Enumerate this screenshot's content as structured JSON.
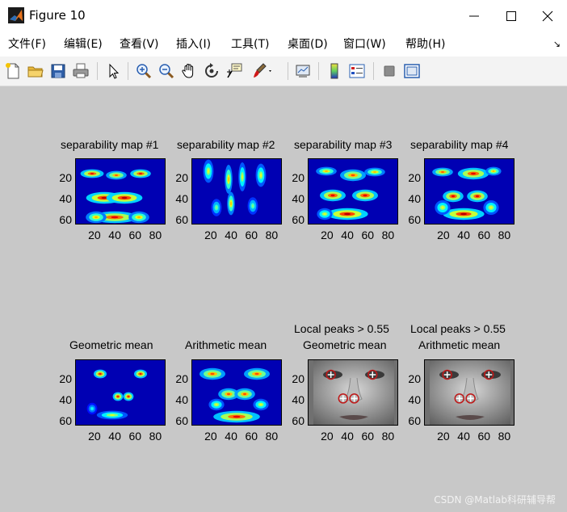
{
  "window": {
    "title": "Figure 10",
    "buttons": [
      "minimize",
      "maximize",
      "close"
    ]
  },
  "menu": {
    "items": [
      "文件(F)",
      "编辑(E)",
      "查看(V)",
      "插入(I)",
      "工具(T)",
      "桌面(D)",
      "窗口(W)",
      "帮助(H)"
    ]
  },
  "toolbar": {
    "buttons": [
      "new-figure",
      "open-file",
      "save",
      "print",
      "edit-plot",
      "zoom-in",
      "zoom-out",
      "pan",
      "rotate-3d",
      "data-cursor",
      "brush",
      "link-plot",
      "insert-colorbar",
      "insert-legend",
      "hide-plot-tools",
      "show-plot-tools"
    ]
  },
  "axes": [
    {
      "title_lines": [
        "separability map #1"
      ],
      "type": "heatmap"
    },
    {
      "title_lines": [
        "separability map #2"
      ],
      "type": "heatmap"
    },
    {
      "title_lines": [
        "separability map #3"
      ],
      "type": "heatmap"
    },
    {
      "title_lines": [
        "separability map #4"
      ],
      "type": "heatmap"
    },
    {
      "title_lines": [
        "Geometric mean"
      ],
      "type": "heatmap"
    },
    {
      "title_lines": [
        "Arithmetic mean"
      ],
      "type": "heatmap"
    },
    {
      "title_lines": [
        "Local peaks > 0.55",
        "Geometric mean"
      ],
      "type": "image"
    },
    {
      "title_lines": [
        "Local peaks > 0.55",
        "Arithmetic mean"
      ],
      "type": "image"
    }
  ],
  "chart_data": [
    {
      "type": "heatmap",
      "title": "separability map #1",
      "xticks": [
        "20",
        "40",
        "60",
        "80"
      ],
      "yticks": [
        "20",
        "40",
        "60"
      ],
      "xlim": [
        1,
        90
      ],
      "ylim": [
        1,
        65
      ],
      "colormap": "jet"
    },
    {
      "type": "heatmap",
      "title": "separability map #2",
      "xticks": [
        "20",
        "40",
        "60",
        "80"
      ],
      "yticks": [
        "20",
        "40",
        "60"
      ],
      "xlim": [
        1,
        90
      ],
      "ylim": [
        1,
        65
      ],
      "colormap": "jet"
    },
    {
      "type": "heatmap",
      "title": "separability map #3",
      "xticks": [
        "20",
        "40",
        "60",
        "80"
      ],
      "yticks": [
        "20",
        "40",
        "60"
      ],
      "xlim": [
        1,
        90
      ],
      "ylim": [
        1,
        65
      ],
      "colormap": "jet"
    },
    {
      "type": "heatmap",
      "title": "separability map #4",
      "xticks": [
        "20",
        "40",
        "60",
        "80"
      ],
      "yticks": [
        "20",
        "40",
        "60"
      ],
      "xlim": [
        1,
        90
      ],
      "ylim": [
        1,
        65
      ],
      "colormap": "jet"
    },
    {
      "type": "heatmap",
      "title": "Geometric mean",
      "xticks": [
        "20",
        "40",
        "60",
        "80"
      ],
      "yticks": [
        "20",
        "40",
        "60"
      ],
      "xlim": [
        1,
        90
      ],
      "ylim": [
        1,
        65
      ],
      "colormap": "jet"
    },
    {
      "type": "heatmap",
      "title": "Arithmetic mean",
      "xticks": [
        "20",
        "40",
        "60",
        "80"
      ],
      "yticks": [
        "20",
        "40",
        "60"
      ],
      "xlim": [
        1,
        90
      ],
      "ylim": [
        1,
        65
      ],
      "colormap": "jet"
    },
    {
      "type": "scatter",
      "title": "Local peaks > 0.55 Geometric mean",
      "xticks": [
        "20",
        "40",
        "60",
        "80"
      ],
      "yticks": [
        "20",
        "40",
        "60"
      ],
      "xlim": [
        1,
        90
      ],
      "ylim": [
        1,
        65
      ],
      "x": [
        23,
        64,
        35,
        46
      ],
      "y": [
        15,
        15,
        38,
        38
      ],
      "marker": "+"
    },
    {
      "type": "scatter",
      "title": "Local peaks > 0.55 Arithmetic mean",
      "xticks": [
        "20",
        "40",
        "60",
        "80"
      ],
      "yticks": [
        "20",
        "40",
        "60"
      ],
      "xlim": [
        1,
        90
      ],
      "ylim": [
        1,
        65
      ],
      "x": [
        23,
        64,
        35,
        46
      ],
      "y": [
        15,
        15,
        38,
        38
      ],
      "marker": "+"
    }
  ],
  "watermark": "CSDN @Matlab科研辅导帮"
}
